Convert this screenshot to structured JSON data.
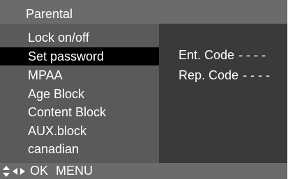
{
  "title": "Parental",
  "menu": {
    "items": [
      {
        "label": "Lock on/off"
      },
      {
        "label": "Set password"
      },
      {
        "label": "MPAA"
      },
      {
        "label": "Age Block"
      },
      {
        "label": "Content Block"
      },
      {
        "label": "AUX.block"
      },
      {
        "label": "canadian"
      }
    ],
    "selected_index": 1
  },
  "detail": {
    "ent_label": "Ent. Code",
    "ent_value": "- - - -",
    "rep_label": "Rep. Code",
    "rep_value": "- - - -"
  },
  "footer": {
    "nav_icons": [
      "up-down-arrow-icon",
      "left-right-arrow-icon"
    ],
    "ok_label": "OK",
    "menu_label": "MENU"
  },
  "colors": {
    "title_bar": "#6b6b6b",
    "menu_panel": "#5a5a5a",
    "detail_panel": "#3a3a3a",
    "selected_row": "#000000",
    "text": "#ffffff"
  }
}
